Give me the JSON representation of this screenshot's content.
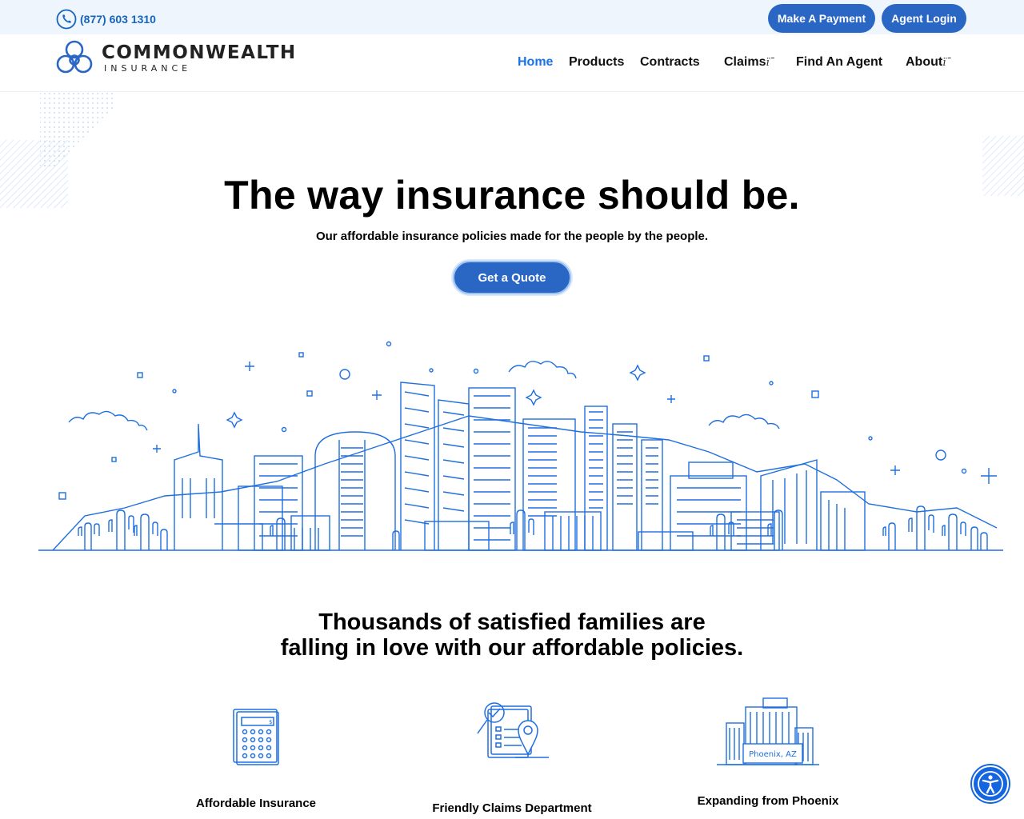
{
  "topbar": {
    "phone": "(877) 603 1310",
    "make_payment": "Make A Payment",
    "agent_login": "Agent Login"
  },
  "logo": {
    "name": "COMMONWEALTH",
    "subtitle": "INSURANCE"
  },
  "nav": {
    "home": "Home",
    "products": "Products",
    "contracts": "Contracts",
    "claims": "Claims",
    "find_agent": "Find An Agent",
    "about": "About",
    "caret": "ï¯"
  },
  "hero": {
    "title": "The way insurance should be.",
    "subtitle": "Our affordable insurance policies made for the people by the people.",
    "cta": "Get a Quote"
  },
  "features": {
    "heading_line1": "Thousands of satisfied families are",
    "heading_line2": "falling in love with our affordable policies.",
    "items": [
      {
        "label": "Affordable Insurance",
        "icon": "calculator-icon"
      },
      {
        "label": "Friendly Claims Department",
        "icon": "claims-form-icon"
      },
      {
        "label": "Expanding from Phoenix",
        "icon": "city-building-icon",
        "badge": "Phoenix, AZ"
      }
    ]
  },
  "colors": {
    "brand_blue": "#2a66c4",
    "link_blue": "#1a73e8",
    "topbar_bg": "#eef5fc",
    "line_blue": "#1f6fe0"
  }
}
